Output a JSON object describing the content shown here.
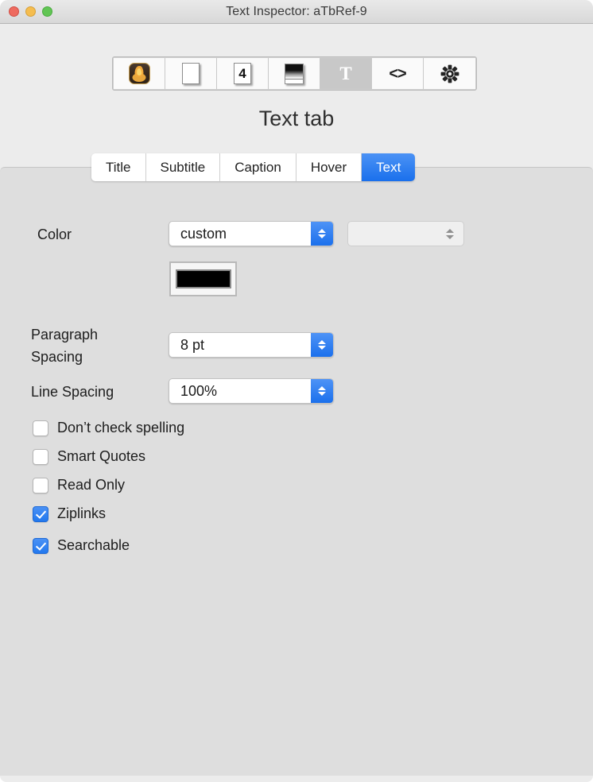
{
  "window": {
    "title": "Text Inspector: aTbRef-9",
    "traffic_lights": [
      {
        "name": "close",
        "color": "#ee6a5f"
      },
      {
        "name": "minimize",
        "color": "#f5bd4f"
      },
      {
        "name": "maximize",
        "color": "#61c554"
      }
    ]
  },
  "toolbar": {
    "items": [
      {
        "icon": "flame-icon",
        "label": "",
        "selected": false
      },
      {
        "icon": "page-icon",
        "label": "",
        "selected": false
      },
      {
        "icon": "page-number-icon",
        "label": "4",
        "selected": false
      },
      {
        "icon": "stacked-page-icon",
        "label": "",
        "selected": false
      },
      {
        "icon": "text-t-icon",
        "label": "T",
        "selected": true
      },
      {
        "icon": "code-brackets-icon",
        "label": "<>",
        "selected": false
      },
      {
        "icon": "gear-icon",
        "label": "",
        "selected": false
      }
    ]
  },
  "heading": "Text tab",
  "tabs": [
    {
      "label": "Title",
      "selected": false
    },
    {
      "label": "Subtitle",
      "selected": false
    },
    {
      "label": "Caption",
      "selected": false
    },
    {
      "label": "Hover",
      "selected": false
    },
    {
      "label": "Text",
      "selected": true
    }
  ],
  "form": {
    "color": {
      "label": "Color",
      "value": "custom",
      "secondary_value": "",
      "swatch_color": "#000000"
    },
    "paragraph_spacing": {
      "label_line1": "Paragraph",
      "label_line2": "Spacing",
      "value": "8 pt"
    },
    "line_spacing": {
      "label": "Line Spacing",
      "value": "100%"
    }
  },
  "checkboxes": [
    {
      "label": "Don’t check spelling",
      "checked": false
    },
    {
      "label": "Smart Quotes",
      "checked": false
    },
    {
      "label": "Read Only",
      "checked": false
    },
    {
      "label": "Ziplinks",
      "checked": true
    },
    {
      "label": "Searchable",
      "checked": true
    }
  ],
  "colors": {
    "accent": "#1b70ec",
    "window_bg": "#ececec",
    "panel_bg": "#dedede"
  }
}
